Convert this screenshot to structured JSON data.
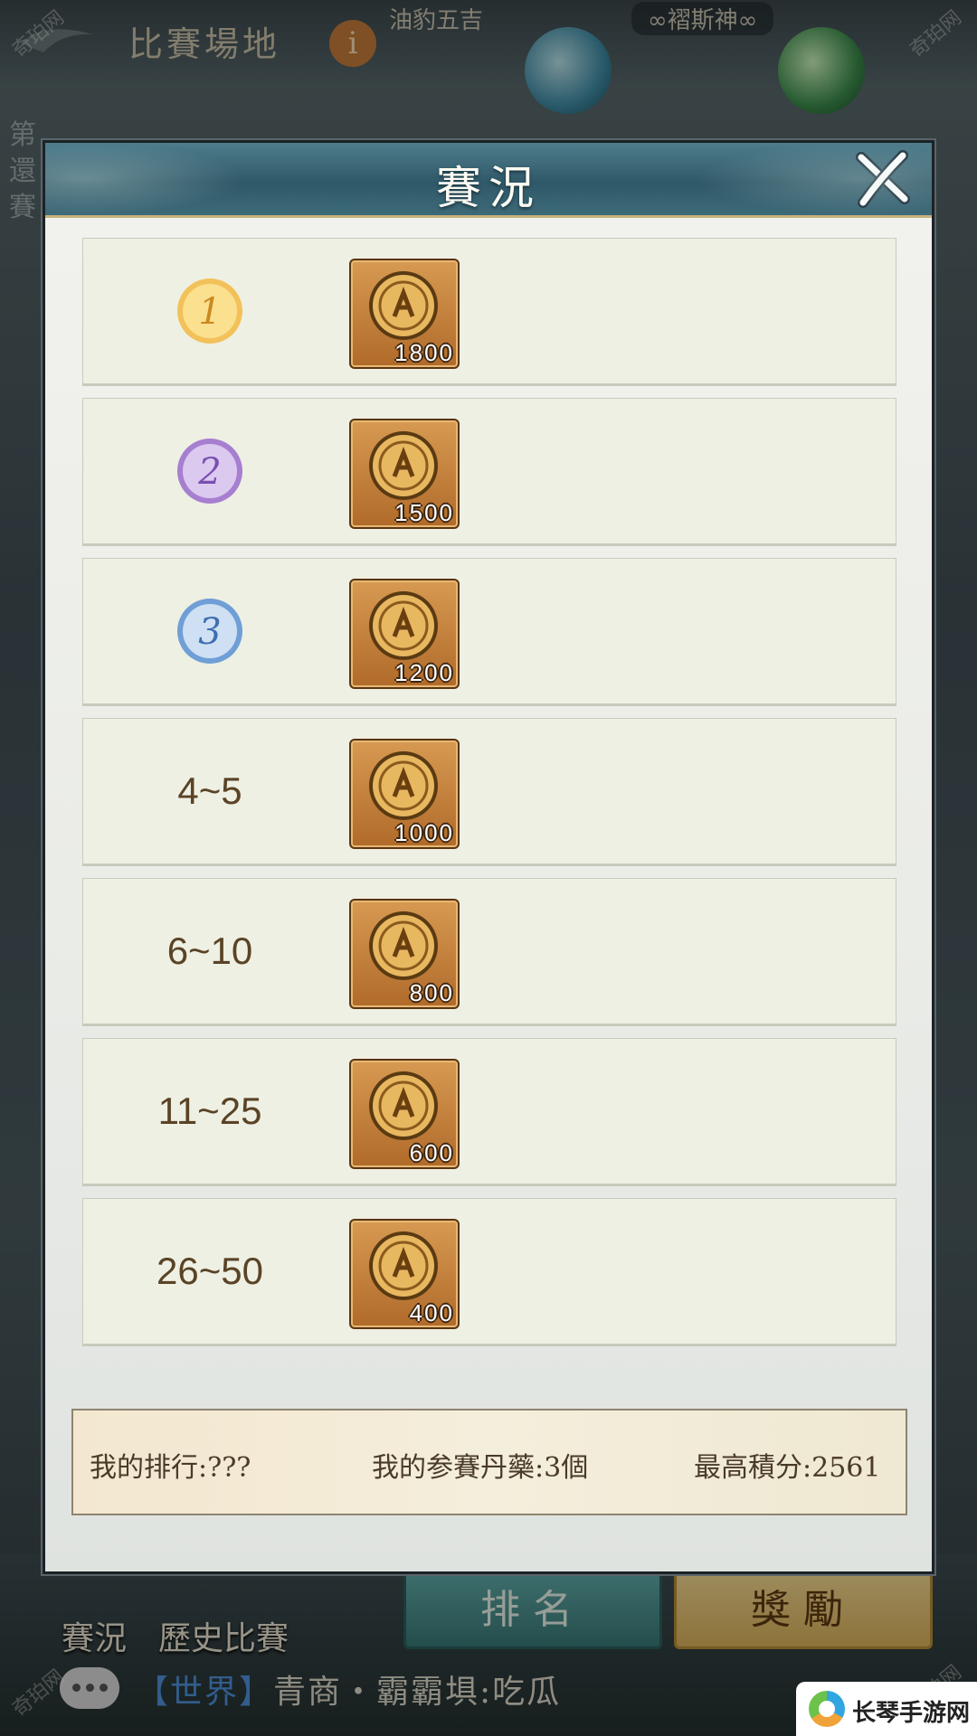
{
  "background": {
    "header_title": "比賽場地",
    "info_glyph": "i",
    "player_1": "油豹五吉",
    "player_2": "∞褶斯神∞",
    "side_text": [
      "第",
      "還",
      "賽"
    ],
    "tabs": [
      "賽況",
      "歷史比賽"
    ],
    "rank_button": "排名",
    "reward_button": "獎勵",
    "chat": {
      "channel": "【世界】",
      "message": "青商・霸霸埧:吃瓜"
    },
    "watermark": "奇珀网",
    "logo_text": "长琴手游网"
  },
  "modal": {
    "title": "賽況",
    "close_label": "close",
    "rows": [
      {
        "rank": "1",
        "medal": "gold",
        "coin_qty": "1800"
      },
      {
        "rank": "2",
        "medal": "purple",
        "coin_qty": "1500"
      },
      {
        "rank": "3",
        "medal": "blue",
        "coin_qty": "1200"
      },
      {
        "rank": "4~5",
        "coin_qty": "1000"
      },
      {
        "rank": "6~10",
        "coin_qty": "800"
      },
      {
        "rank": "11~25",
        "coin_qty": "600"
      },
      {
        "rank": "26~50",
        "coin_qty": "400"
      }
    ],
    "stats": {
      "my_rank": "我的排行:???",
      "my_pills": "我的参賽丹藥:3個",
      "high_score": "最高積分:2561"
    }
  },
  "colors": {
    "header_teal": "#2f5868",
    "row_bg": "#eef0e3",
    "rank_text": "#5a4326",
    "reward_button": "#d9b05a",
    "rank_button": "#387876"
  }
}
